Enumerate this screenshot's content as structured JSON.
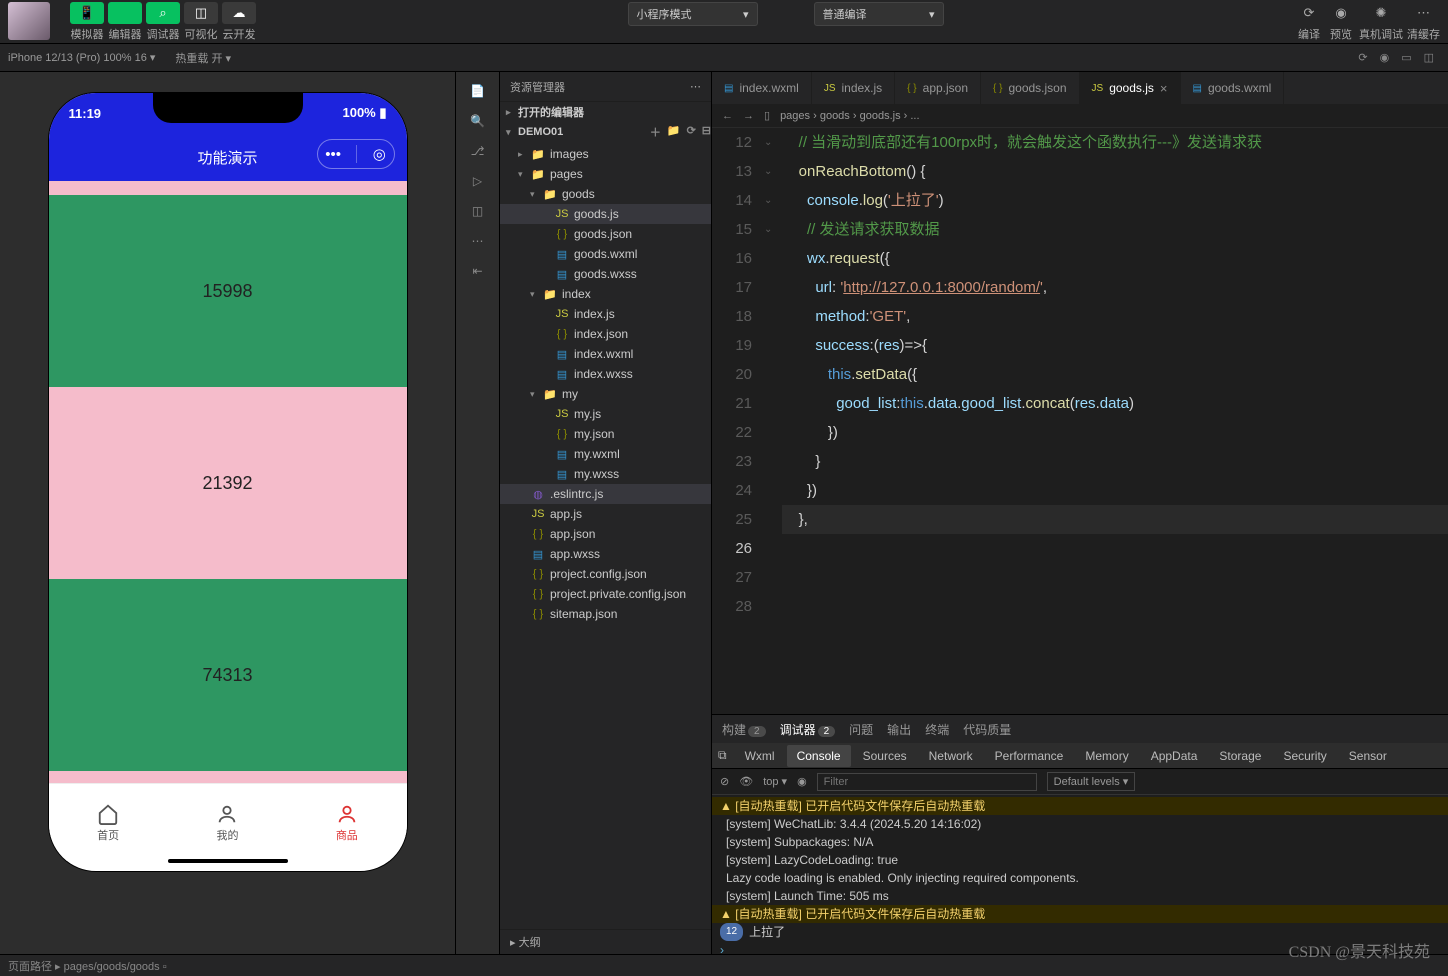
{
  "top": {
    "tools": [
      {
        "icon": "📱",
        "label": "模拟器",
        "cls": "green"
      },
      {
        "icon": "</>",
        "label": "编辑器",
        "cls": "green"
      },
      {
        "icon": "⌕",
        "label": "调试器",
        "cls": "green"
      },
      {
        "icon": "◫",
        "label": "可视化",
        "cls": "gray"
      },
      {
        "icon": "☁",
        "label": "云开发",
        "cls": "gray"
      }
    ],
    "mode": "小程序模式",
    "compile": "普通编译",
    "right": [
      {
        "icon": "⟳",
        "label": "编译"
      },
      {
        "icon": "◉",
        "label": "预览"
      },
      {
        "icon": "✺",
        "label": "真机调试"
      },
      {
        "icon": "⋯",
        "label": "清缓存"
      }
    ]
  },
  "sec": {
    "device": "iPhone 12/13 (Pro) 100% 16 ▾",
    "reload": "热重载 开 ▾"
  },
  "sim": {
    "time": "11:19",
    "battery": "100%",
    "title": "功能演示",
    "blocks": [
      {
        "n": "",
        "c": "pink",
        "h": 14
      },
      {
        "n": "15998",
        "c": "green"
      },
      {
        "n": "21392",
        "c": "pink"
      },
      {
        "n": "74313",
        "c": "green"
      },
      {
        "n": "",
        "c": "pink",
        "h": 20
      }
    ],
    "tabs": [
      {
        "label": "首页",
        "active": false
      },
      {
        "label": "我的",
        "active": false
      },
      {
        "label": "商品",
        "active": true
      }
    ]
  },
  "explorer": {
    "title": "资源管理器",
    "openEditors": "打开的编辑器",
    "project": "DEMO01",
    "tree": [
      {
        "d": 1,
        "t": "folder",
        "open": false,
        "name": "images"
      },
      {
        "d": 1,
        "t": "folder",
        "open": true,
        "name": "pages"
      },
      {
        "d": 2,
        "t": "folder",
        "open": true,
        "name": "goods"
      },
      {
        "d": 3,
        "t": "js",
        "name": "goods.js",
        "sel": true
      },
      {
        "d": 3,
        "t": "json",
        "name": "goods.json"
      },
      {
        "d": 3,
        "t": "wxml",
        "name": "goods.wxml"
      },
      {
        "d": 3,
        "t": "wxss",
        "name": "goods.wxss"
      },
      {
        "d": 2,
        "t": "folder",
        "open": true,
        "name": "index"
      },
      {
        "d": 3,
        "t": "js",
        "name": "index.js"
      },
      {
        "d": 3,
        "t": "json",
        "name": "index.json"
      },
      {
        "d": 3,
        "t": "wxml",
        "name": "index.wxml"
      },
      {
        "d": 3,
        "t": "wxss",
        "name": "index.wxss"
      },
      {
        "d": 2,
        "t": "folder",
        "open": true,
        "name": "my"
      },
      {
        "d": 3,
        "t": "js",
        "name": "my.js"
      },
      {
        "d": 3,
        "t": "json",
        "name": "my.json"
      },
      {
        "d": 3,
        "t": "wxml",
        "name": "my.wxml"
      },
      {
        "d": 3,
        "t": "wxss",
        "name": "my.wxss"
      },
      {
        "d": 1,
        "t": "es",
        "name": ".eslintrc.js",
        "sel2": true
      },
      {
        "d": 1,
        "t": "js",
        "name": "app.js"
      },
      {
        "d": 1,
        "t": "json",
        "name": "app.json"
      },
      {
        "d": 1,
        "t": "wxss",
        "name": "app.wxss"
      },
      {
        "d": 1,
        "t": "json",
        "name": "project.config.json"
      },
      {
        "d": 1,
        "t": "json",
        "name": "project.private.config.json"
      },
      {
        "d": 1,
        "t": "json",
        "name": "sitemap.json"
      }
    ],
    "outline": "大纲"
  },
  "tabs": [
    {
      "icon": "wxml",
      "name": "index.wxml"
    },
    {
      "icon": "js",
      "name": "index.js"
    },
    {
      "icon": "json",
      "name": "app.json"
    },
    {
      "icon": "json",
      "name": "goods.json"
    },
    {
      "icon": "js",
      "name": "goods.js",
      "active": true,
      "close": true
    },
    {
      "icon": "wxml",
      "name": "goods.wxml"
    }
  ],
  "crumbs": [
    "pages",
    "goods",
    "goods.js",
    "..."
  ],
  "code": {
    "start": 12,
    "cur": 26,
    "folds": {
      "13": true,
      "17": true,
      "21": true,
      "22": true
    },
    "lines": [
      "",
      "    // 当滑动到底部还有100rpx时，就会触发这个函数执行---》发送请求获",
      "    onReachBottom() {",
      "      console.log('上拉了')",
      "      // 发送请求获取数据",
      "      wx.request({",
      "        url: 'http://127.0.0.1:8000/random/',",
      "        method:'GET',",
      "        success:(res)=>{",
      "           this.setData({",
      "             good_list:this.data.good_list.concat(res.data)",
      "           })",
      "        }",
      "      })",
      "    },",
      "",
      ""
    ]
  },
  "dbg": {
    "tabs": [
      {
        "name": "构建",
        "badge": "2"
      },
      {
        "name": "调试器",
        "badge": "2",
        "active": true
      },
      {
        "name": "问题"
      },
      {
        "name": "输出"
      },
      {
        "name": "终端"
      },
      {
        "name": "代码质量"
      }
    ],
    "devtabs": [
      "Wxml",
      "Console",
      "Sources",
      "Network",
      "Performance",
      "Memory",
      "AppData",
      "Storage",
      "Security",
      "Sensor"
    ],
    "devactive": "Console",
    "top": "top",
    "filter": "Filter",
    "levels": "Default levels ▾",
    "logs": [
      {
        "t": "warn",
        "msg": "[自动热重载] 已开启代码文件保存后自动热重载"
      },
      {
        "t": "sys",
        "msg": "[system] WeChatLib: 3.4.4 (2024.5.20 14:16:02)"
      },
      {
        "t": "sys",
        "msg": "[system] Subpackages: N/A"
      },
      {
        "t": "sys",
        "msg": "[system] LazyCodeLoading: true"
      },
      {
        "t": "plain",
        "msg": "Lazy code loading is enabled. Only injecting required components."
      },
      {
        "t": "sys",
        "msg": "[system] Launch Time: 505 ms"
      },
      {
        "t": "warn",
        "msg": "[自动热重载] 已开启代码文件保存后自动热重载"
      },
      {
        "t": "count",
        "count": "12",
        "msg": "上拉了"
      }
    ]
  },
  "status": {
    "path": "pages/goods/goods"
  },
  "watermark": "CSDN @景天科技苑"
}
